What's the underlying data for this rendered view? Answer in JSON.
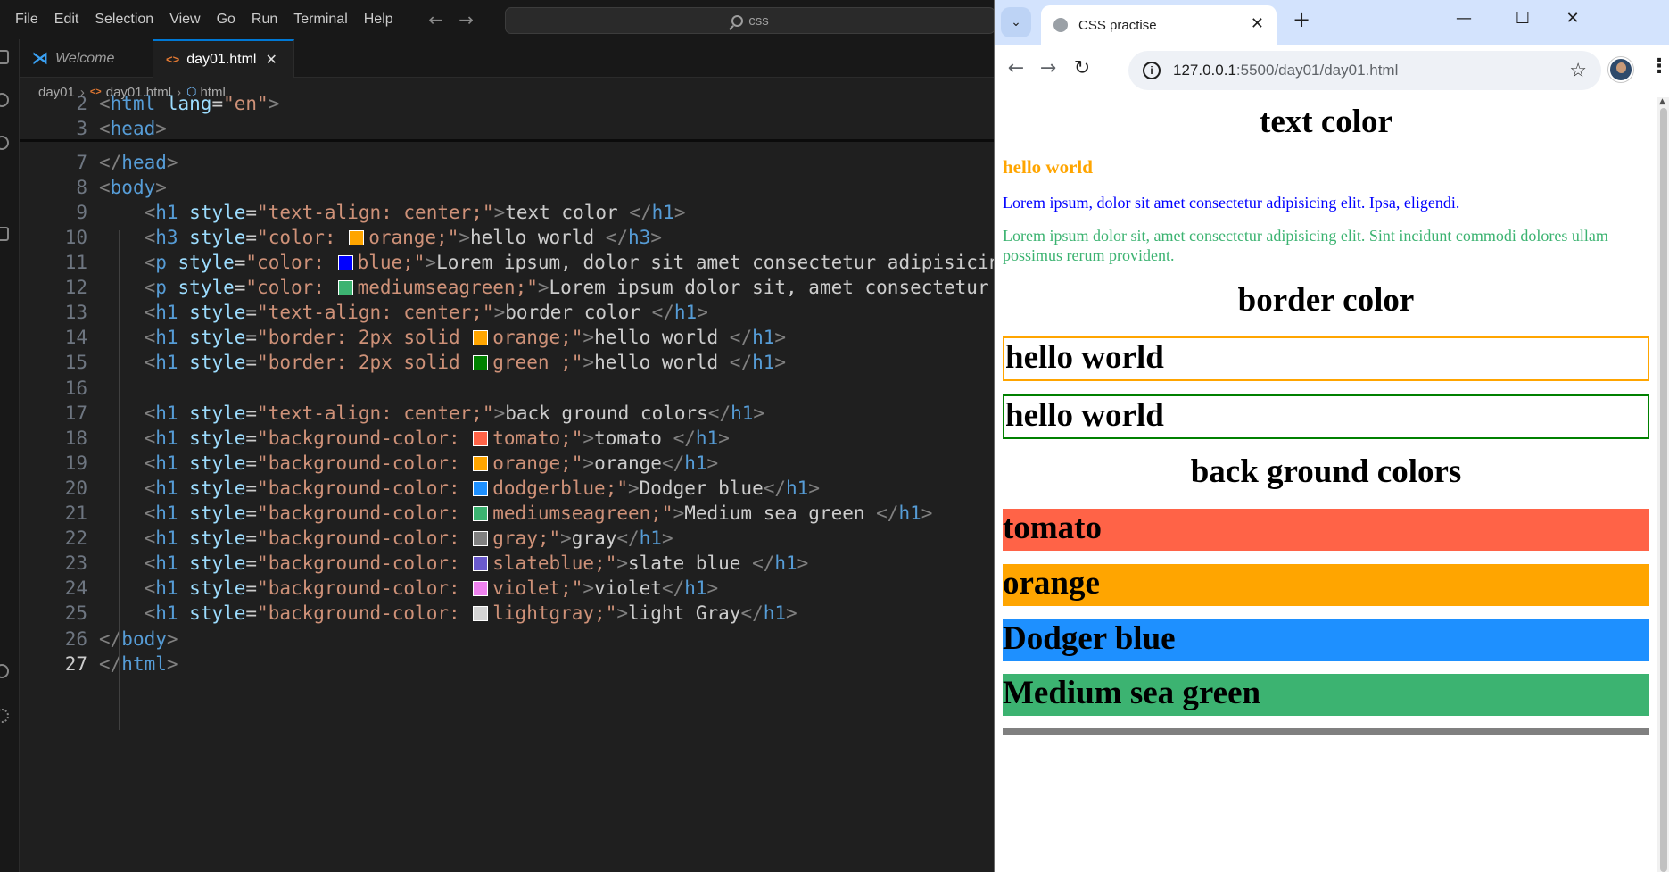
{
  "vscode": {
    "menu": [
      "File",
      "Edit",
      "Selection",
      "View",
      "Go",
      "Run",
      "Terminal",
      "Help"
    ],
    "search_text": "css",
    "tabs": [
      {
        "label": "Welcome"
      },
      {
        "label": "day01.html",
        "close": "✕"
      }
    ],
    "breadcrumb": [
      "day01",
      "day01.html",
      "html"
    ],
    "lines": [
      {
        "num": "2",
        "tokens": [
          [
            "tg",
            "<"
          ],
          [
            "tn",
            "html "
          ],
          [
            "an",
            "lang"
          ],
          [
            "tx",
            "="
          ],
          [
            "av",
            "\"en\""
          ],
          [
            "tg",
            ">"
          ]
        ]
      },
      {
        "num": "3",
        "tokens": [
          [
            "tg",
            "<"
          ],
          [
            "tn",
            "head"
          ],
          [
            "tg",
            ">"
          ]
        ]
      },
      {
        "num": "7",
        "tokens": [
          [
            "tg",
            "</"
          ],
          [
            "tn",
            "head"
          ],
          [
            "tg",
            ">"
          ]
        ]
      },
      {
        "num": "8",
        "tokens": [
          [
            "tg",
            "<"
          ],
          [
            "tn",
            "body"
          ],
          [
            "tg",
            ">"
          ]
        ]
      },
      {
        "num": "9",
        "tokens": [
          [
            "tx",
            "    "
          ],
          [
            "tg",
            "<"
          ],
          [
            "tn",
            "h1 "
          ],
          [
            "an",
            "style"
          ],
          [
            "tx",
            "="
          ],
          [
            "av",
            "\"text-align: center;\""
          ],
          [
            "tg",
            ">"
          ],
          [
            "tx",
            "text color "
          ],
          [
            "tg",
            "</"
          ],
          [
            "tn",
            "h1"
          ],
          [
            "tg",
            ">"
          ]
        ]
      },
      {
        "num": "10",
        "tokens": [
          [
            "tx",
            "    "
          ],
          [
            "tg",
            "<"
          ],
          [
            "tn",
            "h3 "
          ],
          [
            "an",
            "style"
          ],
          [
            "tx",
            "="
          ],
          [
            "av",
            "\"color: "
          ],
          [
            "sw",
            "#ffa500"
          ],
          [
            "av",
            "orange;\""
          ],
          [
            "tg",
            ">"
          ],
          [
            "tx",
            "hello world "
          ],
          [
            "tg",
            "</"
          ],
          [
            "tn",
            "h3"
          ],
          [
            "tg",
            ">"
          ]
        ]
      },
      {
        "num": "11",
        "tokens": [
          [
            "tx",
            "    "
          ],
          [
            "tg",
            "<"
          ],
          [
            "tn",
            "p "
          ],
          [
            "an",
            "style"
          ],
          [
            "tx",
            "="
          ],
          [
            "av",
            "\"color: "
          ],
          [
            "sw",
            "#0000ff"
          ],
          [
            "av",
            "blue;\""
          ],
          [
            "tg",
            ">"
          ],
          [
            "tx",
            "Lorem ipsum, dolor sit amet consectetur adipisicing elit."
          ]
        ]
      },
      {
        "num": "12",
        "tokens": [
          [
            "tx",
            "    "
          ],
          [
            "tg",
            "<"
          ],
          [
            "tn",
            "p "
          ],
          [
            "an",
            "style"
          ],
          [
            "tx",
            "="
          ],
          [
            "av",
            "\"color: "
          ],
          [
            "sw",
            "#3cb371"
          ],
          [
            "av",
            "mediumseagreen;\""
          ],
          [
            "tg",
            ">"
          ],
          [
            "tx",
            "Lorem ipsum dolor sit, amet consectetur adipisicing"
          ]
        ]
      },
      {
        "num": "13",
        "tokens": [
          [
            "tx",
            "    "
          ],
          [
            "tg",
            "<"
          ],
          [
            "tn",
            "h1 "
          ],
          [
            "an",
            "style"
          ],
          [
            "tx",
            "="
          ],
          [
            "av",
            "\"text-align: center;\""
          ],
          [
            "tg",
            ">"
          ],
          [
            "tx",
            "border color "
          ],
          [
            "tg",
            "</"
          ],
          [
            "tn",
            "h1"
          ],
          [
            "tg",
            ">"
          ]
        ]
      },
      {
        "num": "14",
        "tokens": [
          [
            "tx",
            "    "
          ],
          [
            "tg",
            "<"
          ],
          [
            "tn",
            "h1 "
          ],
          [
            "an",
            "style"
          ],
          [
            "tx",
            "="
          ],
          [
            "av",
            "\"border: 2px solid "
          ],
          [
            "sw",
            "#ffa500"
          ],
          [
            "av",
            "orange;\""
          ],
          [
            "tg",
            ">"
          ],
          [
            "tx",
            "hello world "
          ],
          [
            "tg",
            "</"
          ],
          [
            "tn",
            "h1"
          ],
          [
            "tg",
            ">"
          ]
        ]
      },
      {
        "num": "15",
        "tokens": [
          [
            "tx",
            "    "
          ],
          [
            "tg",
            "<"
          ],
          [
            "tn",
            "h1 "
          ],
          [
            "an",
            "style"
          ],
          [
            "tx",
            "="
          ],
          [
            "av",
            "\"border: 2px solid "
          ],
          [
            "sw",
            "#008000"
          ],
          [
            "av",
            "green ;\""
          ],
          [
            "tg",
            ">"
          ],
          [
            "tx",
            "hello world "
          ],
          [
            "tg",
            "</"
          ],
          [
            "tn",
            "h1"
          ],
          [
            "tg",
            ">"
          ]
        ]
      },
      {
        "num": "16",
        "tokens": []
      },
      {
        "num": "17",
        "tokens": [
          [
            "tx",
            "    "
          ],
          [
            "tg",
            "<"
          ],
          [
            "tn",
            "h1 "
          ],
          [
            "an",
            "style"
          ],
          [
            "tx",
            "="
          ],
          [
            "av",
            "\"text-align: center;\""
          ],
          [
            "tg",
            ">"
          ],
          [
            "tx",
            "back ground colors"
          ],
          [
            "tg",
            "</"
          ],
          [
            "tn",
            "h1"
          ],
          [
            "tg",
            ">"
          ]
        ]
      },
      {
        "num": "18",
        "tokens": [
          [
            "tx",
            "    "
          ],
          [
            "tg",
            "<"
          ],
          [
            "tn",
            "h1 "
          ],
          [
            "an",
            "style"
          ],
          [
            "tx",
            "="
          ],
          [
            "av",
            "\"background-color: "
          ],
          [
            "sw",
            "#ff6347"
          ],
          [
            "av",
            "tomato;\""
          ],
          [
            "tg",
            ">"
          ],
          [
            "tx",
            "tomato "
          ],
          [
            "tg",
            "</"
          ],
          [
            "tn",
            "h1"
          ],
          [
            "tg",
            ">"
          ]
        ]
      },
      {
        "num": "19",
        "tokens": [
          [
            "tx",
            "    "
          ],
          [
            "tg",
            "<"
          ],
          [
            "tn",
            "h1 "
          ],
          [
            "an",
            "style"
          ],
          [
            "tx",
            "="
          ],
          [
            "av",
            "\"background-color: "
          ],
          [
            "sw",
            "#ffa500"
          ],
          [
            "av",
            "orange;\""
          ],
          [
            "tg",
            ">"
          ],
          [
            "tx",
            "orange"
          ],
          [
            "tg",
            "</"
          ],
          [
            "tn",
            "h1"
          ],
          [
            "tg",
            ">"
          ]
        ]
      },
      {
        "num": "20",
        "tokens": [
          [
            "tx",
            "    "
          ],
          [
            "tg",
            "<"
          ],
          [
            "tn",
            "h1 "
          ],
          [
            "an",
            "style"
          ],
          [
            "tx",
            "="
          ],
          [
            "av",
            "\"background-color: "
          ],
          [
            "sw",
            "#1e90ff"
          ],
          [
            "av",
            "dodgerblue;\""
          ],
          [
            "tg",
            ">"
          ],
          [
            "tx",
            "Dodger blue"
          ],
          [
            "tg",
            "</"
          ],
          [
            "tn",
            "h1"
          ],
          [
            "tg",
            ">"
          ]
        ]
      },
      {
        "num": "21",
        "tokens": [
          [
            "tx",
            "    "
          ],
          [
            "tg",
            "<"
          ],
          [
            "tn",
            "h1 "
          ],
          [
            "an",
            "style"
          ],
          [
            "tx",
            "="
          ],
          [
            "av",
            "\"background-color: "
          ],
          [
            "sw",
            "#3cb371"
          ],
          [
            "av",
            "mediumseagreen;\""
          ],
          [
            "tg",
            ">"
          ],
          [
            "tx",
            "Medium sea green "
          ],
          [
            "tg",
            "</"
          ],
          [
            "tn",
            "h1"
          ],
          [
            "tg",
            ">"
          ]
        ]
      },
      {
        "num": "22",
        "tokens": [
          [
            "tx",
            "    "
          ],
          [
            "tg",
            "<"
          ],
          [
            "tn",
            "h1 "
          ],
          [
            "an",
            "style"
          ],
          [
            "tx",
            "="
          ],
          [
            "av",
            "\"background-color: "
          ],
          [
            "sw",
            "#808080"
          ],
          [
            "av",
            "gray;\""
          ],
          [
            "tg",
            ">"
          ],
          [
            "tx",
            "gray"
          ],
          [
            "tg",
            "</"
          ],
          [
            "tn",
            "h1"
          ],
          [
            "tg",
            ">"
          ]
        ]
      },
      {
        "num": "23",
        "tokens": [
          [
            "tx",
            "    "
          ],
          [
            "tg",
            "<"
          ],
          [
            "tn",
            "h1 "
          ],
          [
            "an",
            "style"
          ],
          [
            "tx",
            "="
          ],
          [
            "av",
            "\"background-color: "
          ],
          [
            "sw",
            "#6a5acd"
          ],
          [
            "av",
            "slateblue;\""
          ],
          [
            "tg",
            ">"
          ],
          [
            "tx",
            "slate blue "
          ],
          [
            "tg",
            "</"
          ],
          [
            "tn",
            "h1"
          ],
          [
            "tg",
            ">"
          ]
        ]
      },
      {
        "num": "24",
        "tokens": [
          [
            "tx",
            "    "
          ],
          [
            "tg",
            "<"
          ],
          [
            "tn",
            "h1 "
          ],
          [
            "an",
            "style"
          ],
          [
            "tx",
            "="
          ],
          [
            "av",
            "\"background-color: "
          ],
          [
            "sw",
            "#ee82ee"
          ],
          [
            "av",
            "violet;\""
          ],
          [
            "tg",
            ">"
          ],
          [
            "tx",
            "violet"
          ],
          [
            "tg",
            "</"
          ],
          [
            "tn",
            "h1"
          ],
          [
            "tg",
            ">"
          ]
        ]
      },
      {
        "num": "25",
        "tokens": [
          [
            "tx",
            "    "
          ],
          [
            "tg",
            "<"
          ],
          [
            "tn",
            "h1 "
          ],
          [
            "an",
            "style"
          ],
          [
            "tx",
            "="
          ],
          [
            "av",
            "\"background-color: "
          ],
          [
            "sw",
            "#d3d3d3"
          ],
          [
            "av",
            "lightgray;\""
          ],
          [
            "tg",
            ">"
          ],
          [
            "tx",
            "light Gray"
          ],
          [
            "tg",
            "</"
          ],
          [
            "tn",
            "h1"
          ],
          [
            "tg",
            ">"
          ]
        ]
      },
      {
        "num": "26",
        "tokens": [
          [
            "tg",
            "</"
          ],
          [
            "tn",
            "body"
          ],
          [
            "tg",
            ">"
          ]
        ]
      },
      {
        "num": "27",
        "tokens": [
          [
            "tg",
            "</"
          ],
          [
            "tn",
            "html"
          ],
          [
            "tg",
            ">"
          ]
        ]
      }
    ]
  },
  "chrome": {
    "tab_title": "CSS practise",
    "url_host": "127.0.0.1",
    "url_path": ":5500/day01/day01.html",
    "page": {
      "h1_text_color": "text color",
      "h3_hello": "hello world",
      "p_blue": "Lorem ipsum, dolor sit amet consectetur adipisicing elit. Ipsa, eligendi.",
      "p_green": "Lorem ipsum dolor sit, amet consectetur adipisicing elit. Sint incidunt commodi dolores ullam possimus rerum provident.",
      "h1_border_color": "border color",
      "border_orange": "hello world",
      "border_green": "hello world",
      "h1_bg_colors": "back ground colors",
      "bg_tomato": "tomato",
      "bg_orange": "orange",
      "bg_dodgerblue": "Dodger blue",
      "bg_mediumseagreen": "Medium sea green"
    }
  },
  "colors": {
    "orange": "#ffa500",
    "blue": "#0000ff",
    "mediumseagreen": "#3cb371",
    "green": "#008000",
    "tomato": "#ff6347",
    "dodgerblue": "#1e90ff",
    "gray": "#808080",
    "vscode_accent": "#0078d4"
  }
}
